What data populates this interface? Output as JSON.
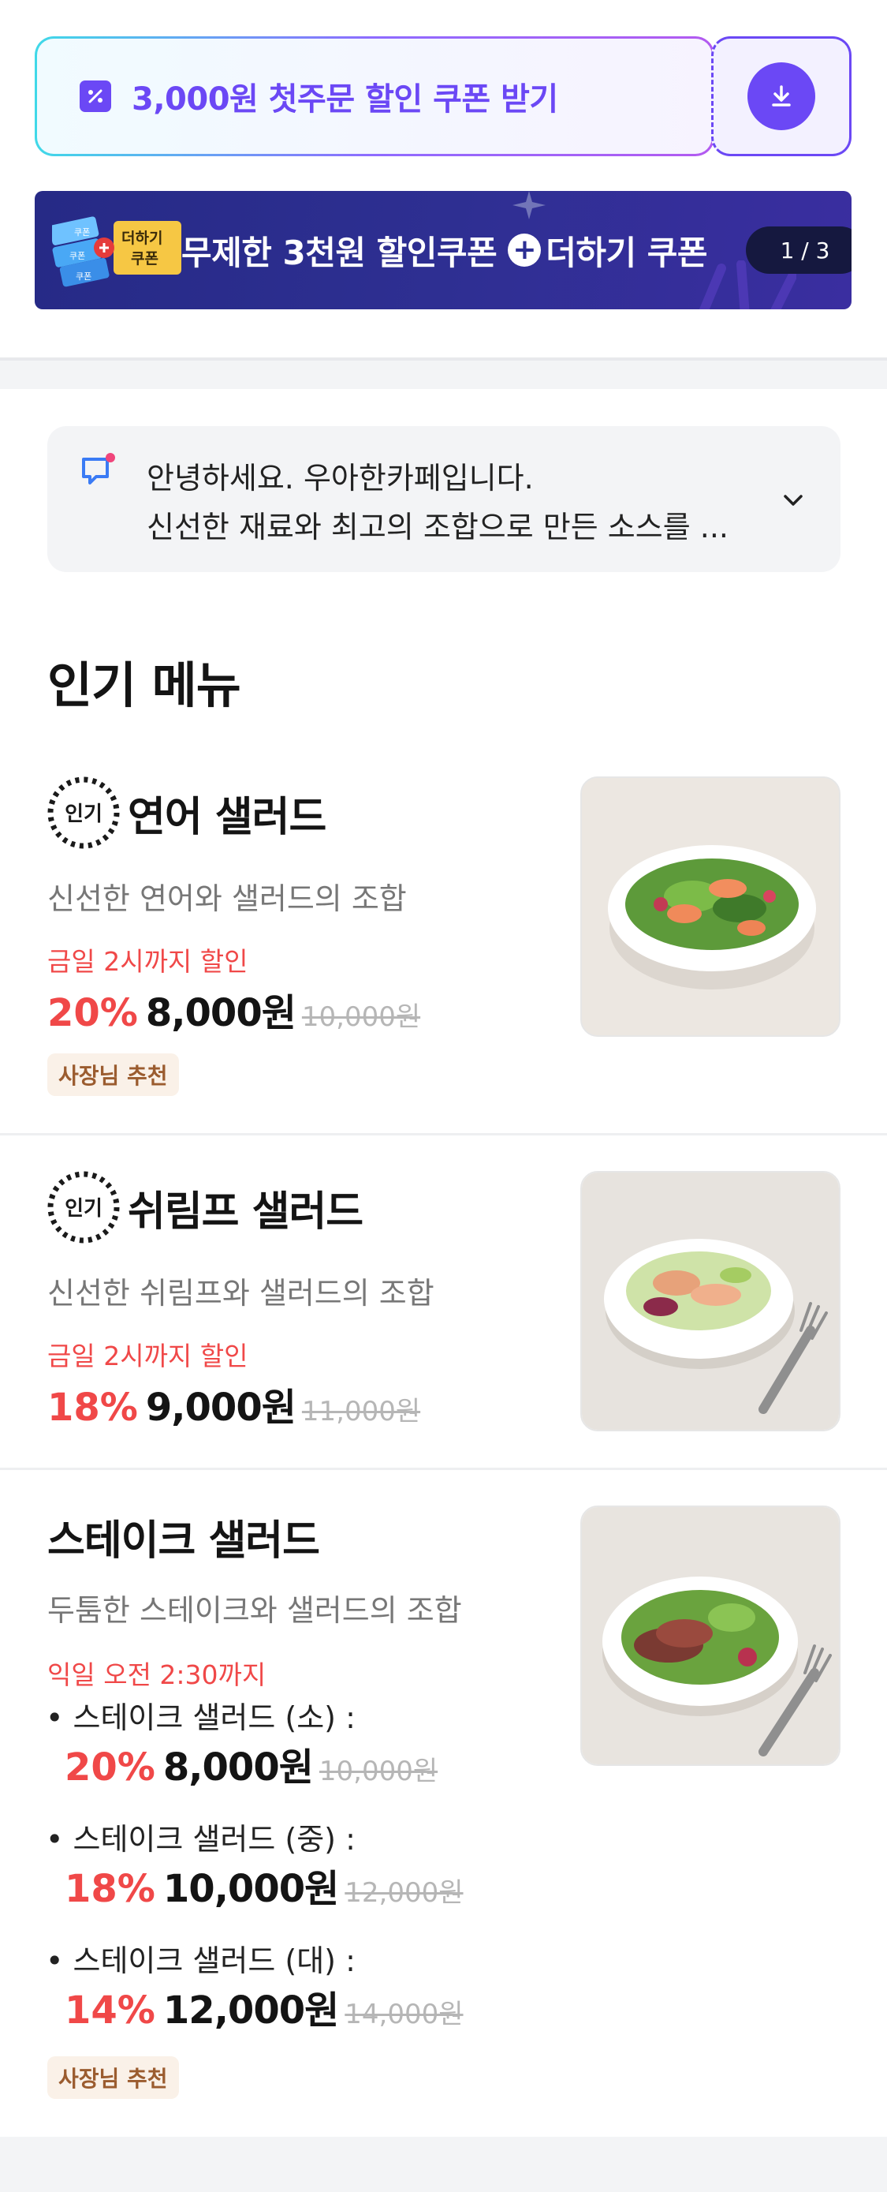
{
  "colors": {
    "brand_purple": "#6b48f5",
    "discount_red": "#f04848",
    "banner_navy": "#2e2f92",
    "recommend_bg": "#faf1e8",
    "recommend_text": "#9b5c2f"
  },
  "coupon": {
    "text": "3,000원 첫주문 할인 쿠폰 받기",
    "icon": "coupon-percent-icon",
    "download_icon": "download-icon"
  },
  "promo_banner": {
    "ticket_labels": [
      "쿠폰",
      "쿠폰",
      "쿠폰",
      "더하기",
      "쿠폰"
    ],
    "text_before": "무제한 3천원 할인쿠폰",
    "plus": "+",
    "text_after": "더하기 쿠폰",
    "page_indicator": "1 / 3"
  },
  "notice": {
    "line1": "안녕하세요. 우아한카페입니다.",
    "line2": "신선한 재료와 최고의 조합으로 만든 소스를 ...",
    "icon": "chat-notice-icon",
    "expand_icon": "chevron-down-icon"
  },
  "section": {
    "title": "인기 메뉴"
  },
  "menu": [
    {
      "badge": "인기",
      "name": "연어 샐러드",
      "desc": "신선한 연어와 샐러드의 조합",
      "promo": "금일 2시까지 할인",
      "discount": "20%",
      "price": "8,000원",
      "original": "10,000원",
      "recommend": "사장님 추천"
    },
    {
      "badge": "인기",
      "name": "쉬림프 샐러드",
      "desc": "신선한 쉬림프와 샐러드의 조합",
      "promo": "금일 2시까지 할인",
      "discount": "18%",
      "price": "9,000원",
      "original": "11,000원"
    },
    {
      "name": "스테이크 샐러드",
      "desc": "두툼한 스테이크와 샐러드의 조합",
      "promo": "익일 오전 2:30까지",
      "options": [
        {
          "label": "스테이크 샐러드 (소) :",
          "discount": "20%",
          "price": "8,000원",
          "original": "10,000원"
        },
        {
          "label": "스테이크 샐러드 (중) :",
          "discount": "18%",
          "price": "10,000원",
          "original": "12,000원"
        },
        {
          "label": "스테이크 샐러드 (대) :",
          "discount": "14%",
          "price": "12,000원",
          "original": "14,000원"
        }
      ],
      "recommend": "사장님 추천"
    }
  ]
}
